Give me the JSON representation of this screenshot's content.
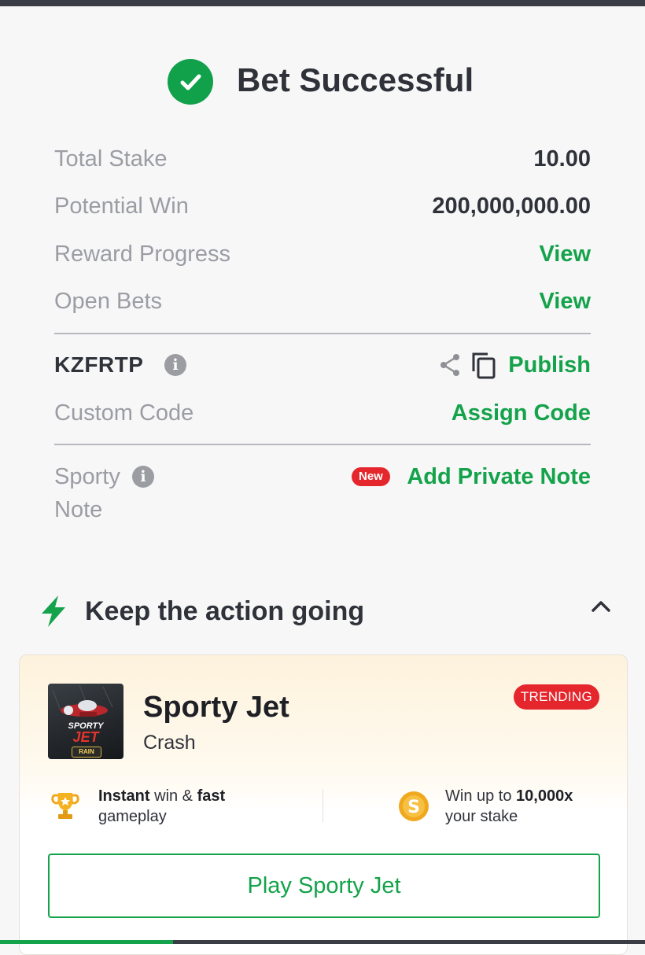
{
  "header": {
    "title": "Bet Successful"
  },
  "summary": {
    "total_stake_label": "Total Stake",
    "total_stake_value": "10.00",
    "potential_win_label": "Potential Win",
    "potential_win_value": "200,000,000.00",
    "reward_progress_label": "Reward Progress",
    "reward_progress_link": "View",
    "open_bets_label": "Open Bets",
    "open_bets_link": "View"
  },
  "booking": {
    "code": "KZFRTP",
    "info_glyph": "i",
    "publish_label": "Publish",
    "custom_code_label": "Custom Code",
    "assign_code_label": "Assign Code"
  },
  "note": {
    "label_line1": "Sporty",
    "label_line2": "Note",
    "info_glyph": "i",
    "new_badge": "New",
    "add_note_label": "Add Private Note"
  },
  "promo": {
    "section_title": "Keep the action going",
    "game_title": "Sporty Jet",
    "game_category": "Crash",
    "trending_badge": "TRENDING",
    "thumb_text_top": "SPORTY",
    "thumb_text_main": "JET",
    "thumb_text_badge": "RAIN",
    "feature1_bold1": "Instant",
    "feature1_text1": " win & ",
    "feature1_bold2": "fast",
    "feature1_text2": "gameplay",
    "feature2_text1": "Win up to ",
    "feature2_bold": "10,000x",
    "feature2_text2": "your stake",
    "play_button": "Play Sporty Jet"
  },
  "icons": {
    "check": "check-circle-icon",
    "info": "info-icon",
    "share": "share-icon",
    "copy": "copy-icon",
    "lightning": "lightning-icon",
    "chevron": "chevron-up-icon",
    "trophy": "trophy-icon",
    "coin": "coin-icon"
  },
  "colors": {
    "accent_green": "#14a34a",
    "badge_red": "#e5262d",
    "muted_text": "#9b9da3",
    "dark_text": "#30323a"
  }
}
